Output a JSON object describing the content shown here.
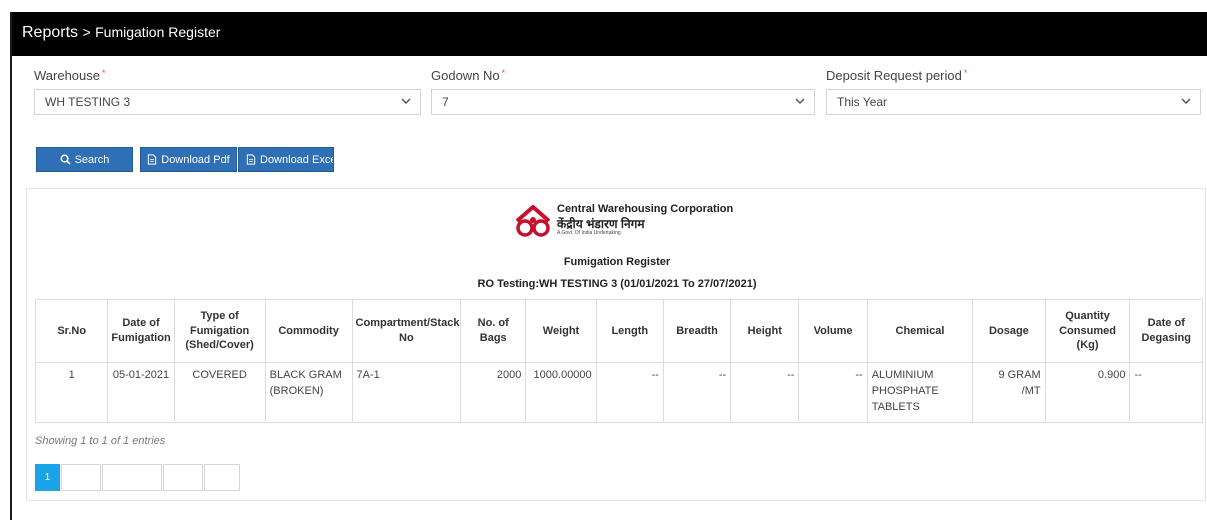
{
  "header": {
    "section": "Reports",
    "separator": ">",
    "page": "Fumigation Register"
  },
  "filters": {
    "warehouse": {
      "label": "Warehouse",
      "required": "*",
      "value": "WH TESTING 3"
    },
    "godown": {
      "label": "Godown No",
      "required": "*",
      "value": "7"
    },
    "period": {
      "label": "Deposit Request period",
      "required": "*",
      "value": "This Year"
    }
  },
  "buttons": {
    "search": "Search",
    "download_pdf": "Download Pdf",
    "download_excel": "Download Excel"
  },
  "report": {
    "org_english": "Central Warehousing Corporation",
    "org_hindi": "केंद्रीय भंडारण निगम",
    "org_tagline": "A Govt. Of India Undertaking",
    "title": "Fumigation Register",
    "subtitle": "RO Testing:WH TESTING 3 (01/01/2021 To 27/07/2021)"
  },
  "table": {
    "columns": [
      "Sr.No",
      "Date of Fumigation",
      "Type of Fumigation (Shed/Cover)",
      "Commodity",
      "Compartment/Stack No",
      "No. of Bags",
      "Weight",
      "Length",
      "Breadth",
      "Height",
      "Volume",
      "Chemical",
      "Dosage",
      "Quantity Consumed (Kg)",
      "Date of Degasing"
    ],
    "rows": [
      [
        "1",
        "05-01-2021",
        "COVERED",
        "BLACK GRAM (BROKEN)",
        "7A-1",
        "2000",
        "1000.00000",
        "--",
        "--",
        "--",
        "--",
        "ALUMINIUM PHOSPHATE TABLETS",
        "9 GRAM /MT",
        "0.900",
        "--"
      ]
    ]
  },
  "footer": {
    "entries": "Showing 1 to 1 of 1 entries"
  },
  "pagination": {
    "current": "1"
  },
  "colors": {
    "topbar": "#000000",
    "primary_button": "#2f6fb6",
    "active_page": "#1aa3e6",
    "required": "#e2534a",
    "logo": "#c8102e"
  },
  "icons": {
    "search": "search-icon",
    "pdf": "file-icon",
    "excel": "file-icon",
    "dropdown": "chevron-down-icon",
    "logo": "cwc-logo"
  }
}
